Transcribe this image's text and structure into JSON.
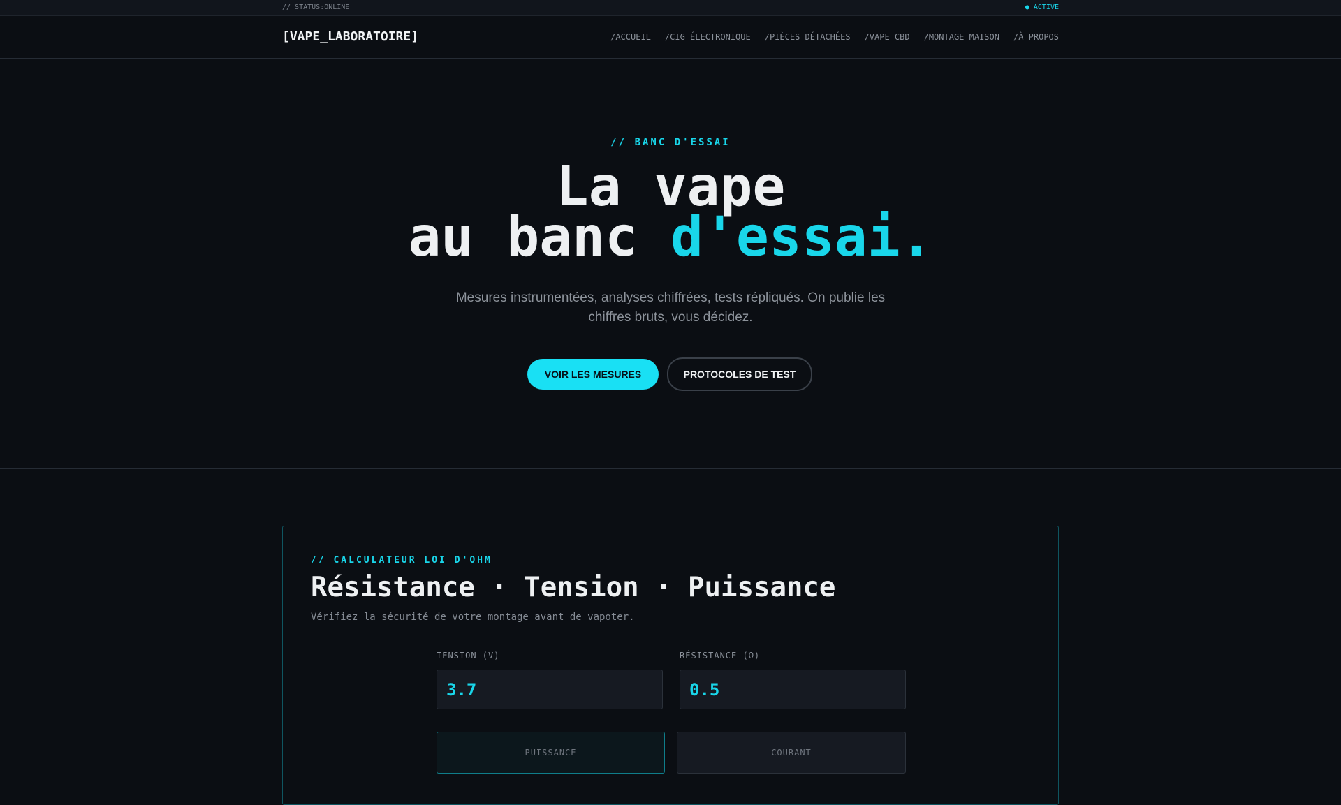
{
  "topbar": {
    "status": "// STATUS:ONLINE",
    "indicator": "● ACTIVE"
  },
  "nav": {
    "logo": "[VAPE_LABORATOIRE]",
    "items": [
      "/ACCUEIL",
      "/CIG ÉLECTRONIQUE",
      "/PIÈCES DÉTACHÉES",
      "/VAPE CBD",
      "/MONTAGE MAISON",
      "/À PROPOS"
    ]
  },
  "hero": {
    "eyebrow": "// BANC D'ESSAI",
    "title_line1": "La vape",
    "title_line2_a": "au banc ",
    "title_line2_b": "d'essai.",
    "subtitle": "Mesures instrumentées, analyses chiffrées, tests répliqués. On publie les chiffres bruts, vous décidez.",
    "primary_button": "VOIR LES MESURES",
    "secondary_button": "PROTOCOLES DE TEST"
  },
  "calculator": {
    "label": "// CALCULATEUR LOI D'OHM",
    "title": "Résistance · Tension · Puissance",
    "subtitle": "Vérifiez la sécurité de votre montage avant de vapoter.",
    "voltage_label": "TENSION (V)",
    "voltage_value": "3.7",
    "resistance_label": "RÉSISTANCE (Ω)",
    "resistance_value": "0.5",
    "results": [
      "PUISSANCE",
      "COURANT"
    ]
  },
  "colors": {
    "accent": "#19d6ea",
    "background": "#0b0e13"
  }
}
